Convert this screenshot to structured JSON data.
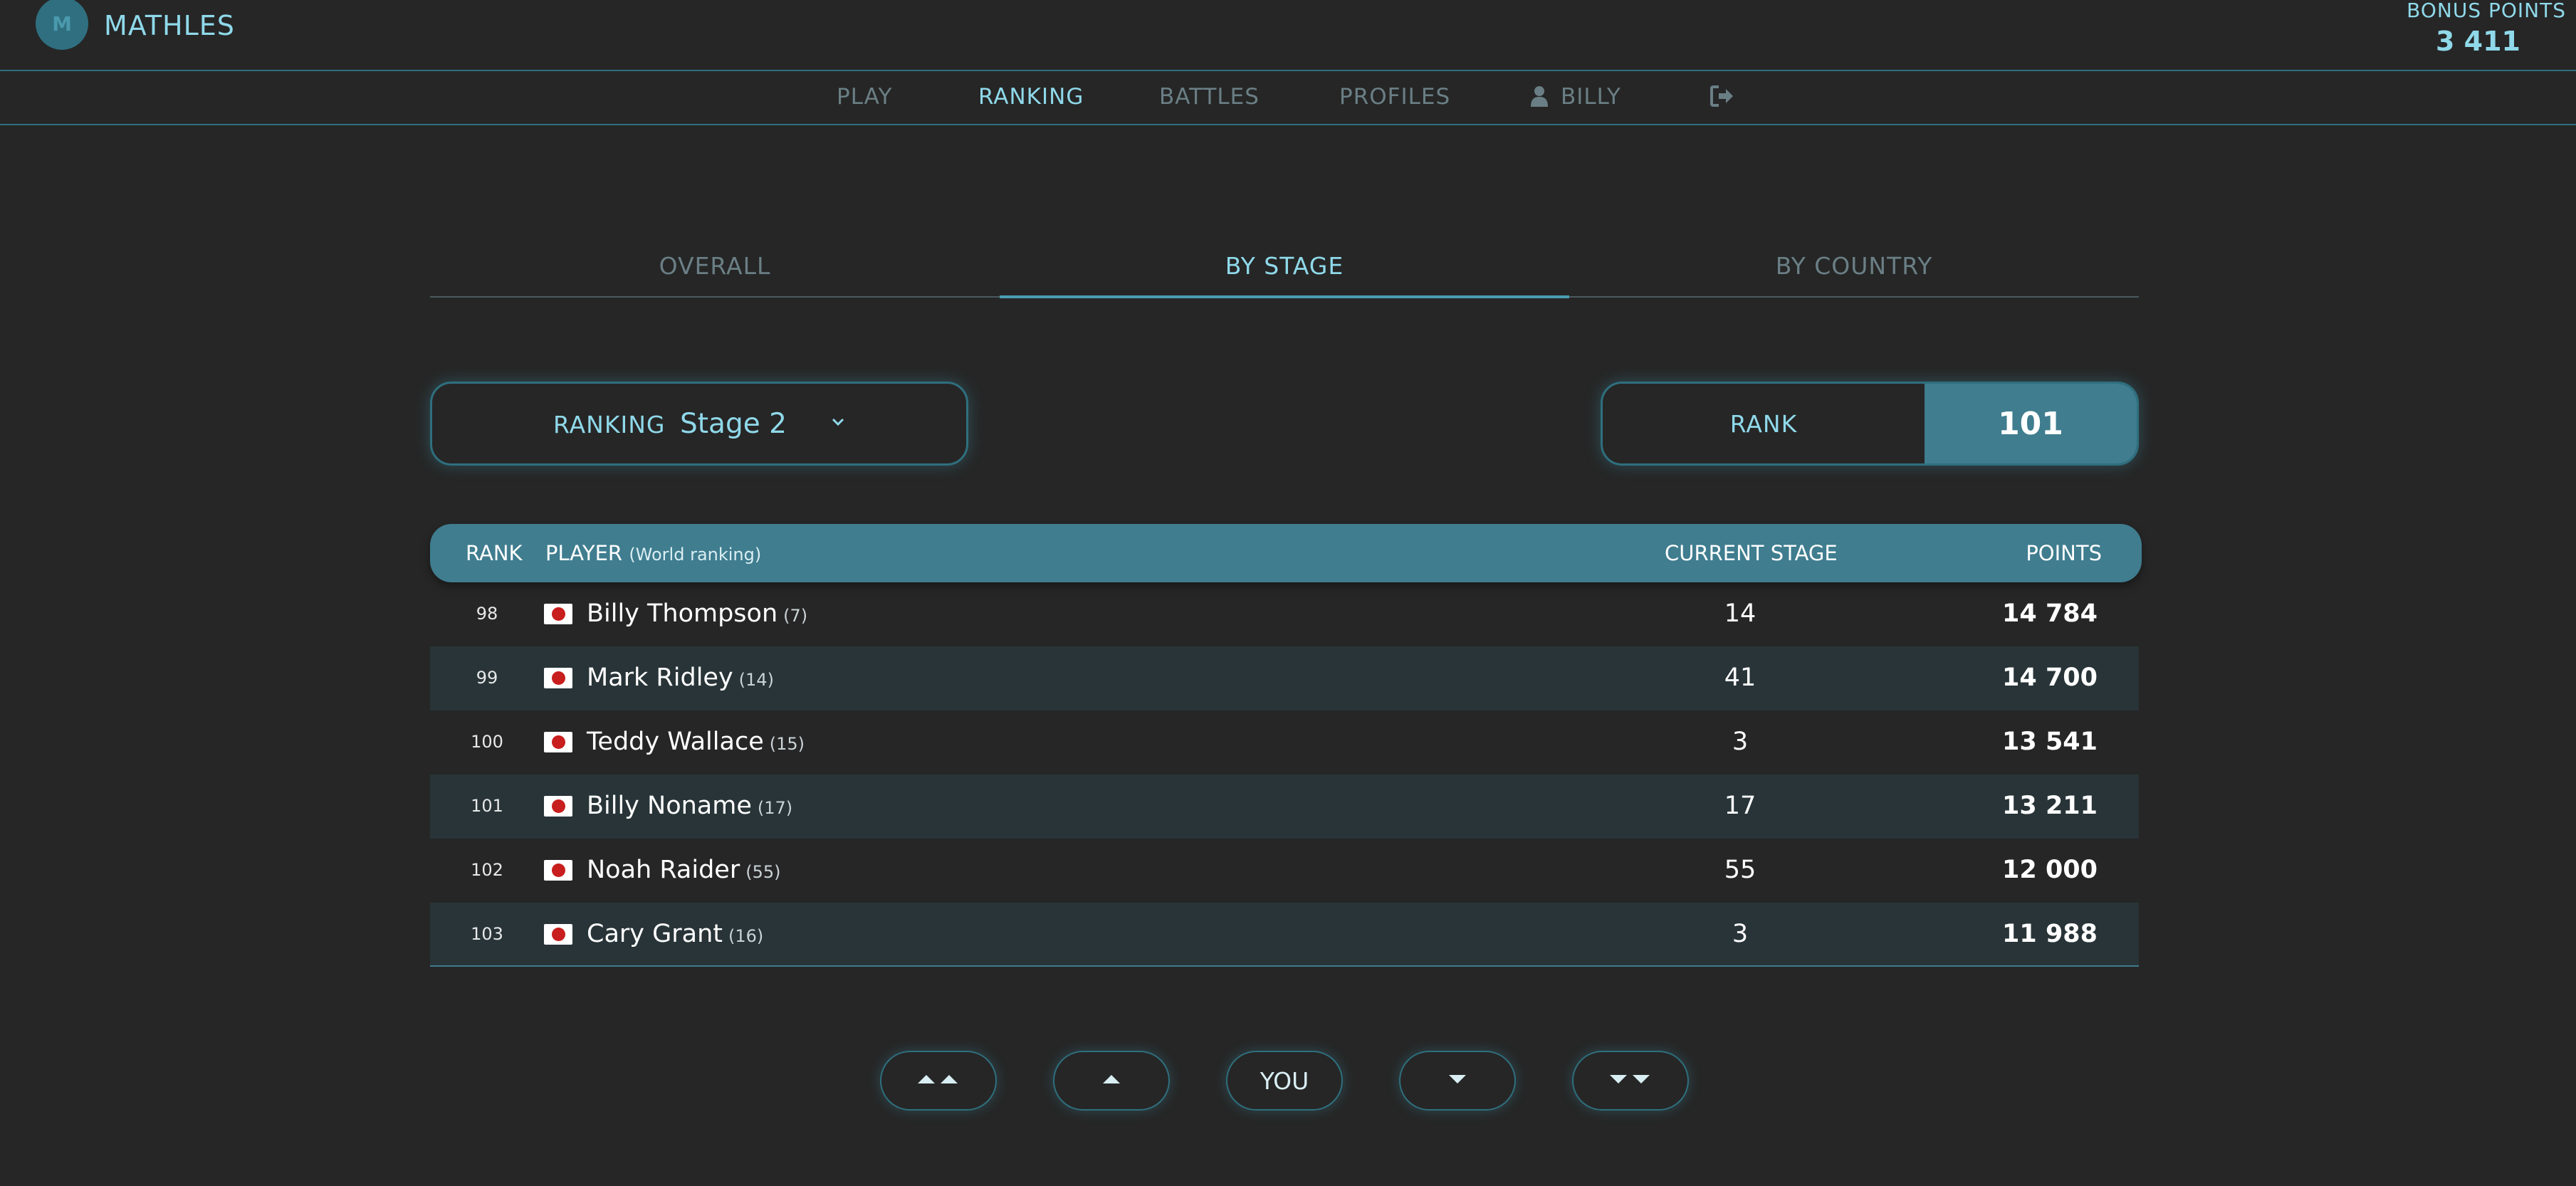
{
  "header": {
    "app_title": "MATHLES",
    "logo_icon": "mathles-logo-icon",
    "bonus_label": "BONUS POINTS",
    "bonus_value": "3 411"
  },
  "nav": {
    "items": [
      {
        "label": "PLAY",
        "active": false
      },
      {
        "label": "RANKING",
        "active": true
      },
      {
        "label": "BATTLES",
        "active": false
      },
      {
        "label": "PROFILES",
        "active": false
      },
      {
        "label": "BILLY",
        "active": false,
        "icon": "user-icon"
      }
    ],
    "logout_icon": "logout-icon"
  },
  "tabs": [
    {
      "label": "OVERALL",
      "active": false
    },
    {
      "label": "BY STAGE",
      "active": true
    },
    {
      "label": "BY COUNTRY",
      "active": false
    }
  ],
  "ranking_select": {
    "label": "RANKING",
    "value": "Stage 2",
    "icon": "chevron-down-icon"
  },
  "rank_box": {
    "label": "RANK",
    "value": "101"
  },
  "table": {
    "headers": {
      "rank": "RANK",
      "player": "PLAYER",
      "player_note": "(World ranking)",
      "current_stage": "CURRENT STAGE",
      "points": "POINTS"
    },
    "rows": [
      {
        "rank": "98",
        "name": "Billy Thompson",
        "world_rank": "(7)",
        "stage": "14",
        "points": "14 784"
      },
      {
        "rank": "99",
        "name": "Mark Ridley",
        "world_rank": "(14)",
        "stage": "41",
        "points": "14 700"
      },
      {
        "rank": "100",
        "name": "Teddy Wallace",
        "world_rank": "(15)",
        "stage": "3",
        "points": "13 541"
      },
      {
        "rank": "101",
        "name": "Billy Noname",
        "world_rank": "(17)",
        "stage": "17",
        "points": "13 211"
      },
      {
        "rank": "102",
        "name": "Noah Raider",
        "world_rank": "(55)",
        "stage": "55",
        "points": "12 000"
      },
      {
        "rank": "103",
        "name": "Cary Grant",
        "world_rank": "(16)",
        "stage": "3",
        "points": "11 988"
      }
    ]
  },
  "pager": {
    "first_icon": "double-caret-up-icon",
    "prev_icon": "caret-up-icon",
    "you_label": "YOU",
    "next_icon": "caret-down-icon",
    "last_icon": "double-caret-down-icon"
  },
  "colors": {
    "background": "#262626",
    "accent": "#8fd9ea",
    "teal": "#3f7d8f",
    "muted": "#6a7f85",
    "row_alt": "#283438"
  }
}
